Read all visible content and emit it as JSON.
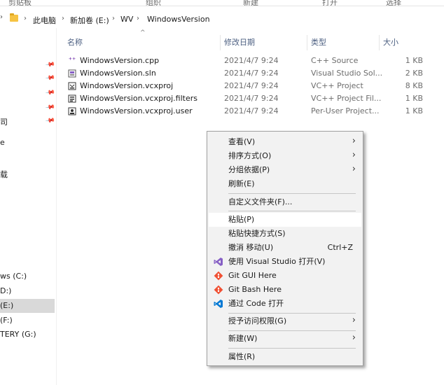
{
  "ribbon": {
    "groups": [
      "剪贴板",
      "组织",
      "新建",
      "打开",
      "选择"
    ]
  },
  "address": {
    "crumbs": [
      "此电脑",
      "新加卷 (E:)",
      "WV",
      "WindowsVersion"
    ]
  },
  "nav": {
    "items": [
      "司",
      "e",
      "载",
      "ws (C:)",
      "D:)",
      "(E:)",
      "(F:)",
      "TERY (G:)"
    ]
  },
  "columns": {
    "name": "名称",
    "date": "修改日期",
    "type": "类型",
    "size": "大小"
  },
  "files": [
    {
      "name": "WindowsVersion.cpp",
      "date": "2021/4/7 9:24",
      "type": "C++ Source",
      "size": "1 KB"
    },
    {
      "name": "WindowsVersion.sln",
      "date": "2021/4/7 9:24",
      "type": "Visual Studio Sol...",
      "size": "2 KB"
    },
    {
      "name": "WindowsVersion.vcxproj",
      "date": "2021/4/7 9:24",
      "type": "VC++ Project",
      "size": "8 KB"
    },
    {
      "name": "WindowsVersion.vcxproj.filters",
      "date": "2021/4/7 9:24",
      "type": "VC++ Project Fil...",
      "size": "1 KB"
    },
    {
      "name": "WindowsVersion.vcxproj.user",
      "date": "2021/4/7 9:24",
      "type": "Per-User Project...",
      "size": "1 KB"
    }
  ],
  "menu": {
    "view": "查看(V)",
    "sort": "排序方式(O)",
    "group": "分组依据(P)",
    "refresh": "刷新(E)",
    "customize": "自定义文件夹(F)...",
    "paste": "粘贴(P)",
    "paste_shortcut": "粘贴快捷方式(S)",
    "undo_move": "撤消 移动(U)",
    "undo_shortcut": "Ctrl+Z",
    "open_vs": "使用 Visual Studio 打开(V)",
    "git_gui": "Git GUI Here",
    "git_bash": "Git Bash Here",
    "open_code": "通过 Code 打开",
    "grant_access": "授予访问权限(G)",
    "new": "新建(W)",
    "properties": "属性(R)"
  },
  "colors": {
    "vs_purple": "#865fc5",
    "git_orange": "#f05033",
    "code_blue": "#0078d4",
    "header_text": "#4d6082"
  }
}
